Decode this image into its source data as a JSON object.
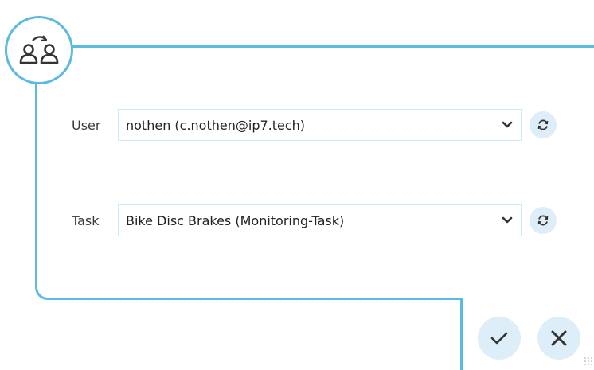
{
  "form": {
    "user": {
      "label": "User",
      "value": "nothen (c.nothen@ip7.tech)"
    },
    "task": {
      "label": "Task",
      "value": "Bike Disc Brakes (Monitoring-Task)"
    }
  },
  "icons": {
    "badge": "user-switch-icon",
    "dropdown": "chevron-down-icon",
    "refresh": "refresh-icon",
    "confirm": "checkmark-icon",
    "cancel": "close-icon",
    "grip": "resize-grip-icon"
  },
  "colors": {
    "accent_border": "#5cb9df",
    "button_bg": "#ddeef8",
    "field_border": "#cfe9f6",
    "icon": "#333333"
  }
}
